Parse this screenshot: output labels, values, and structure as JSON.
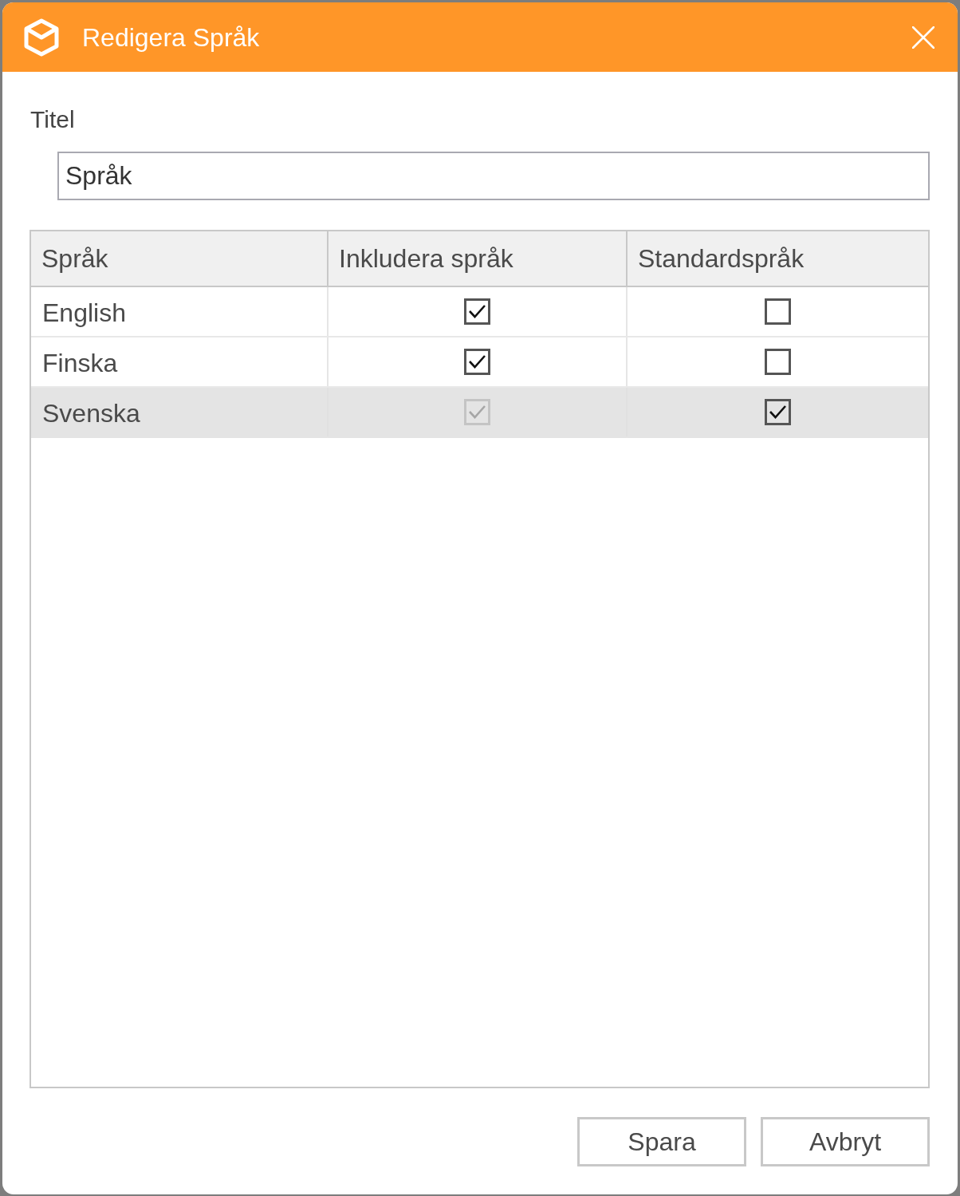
{
  "window": {
    "title": "Redigera Språk"
  },
  "form": {
    "label": "Titel",
    "value": "Språk"
  },
  "table": {
    "columns": [
      "Språk",
      "Inkludera språk",
      "Standardspråk"
    ],
    "rows": [
      {
        "language": "English",
        "selected": false,
        "include": {
          "checked": true,
          "disabled": false
        },
        "default": {
          "checked": false,
          "disabled": false
        }
      },
      {
        "language": "Finska",
        "selected": false,
        "include": {
          "checked": true,
          "disabled": false
        },
        "default": {
          "checked": false,
          "disabled": false
        }
      },
      {
        "language": "Svenska",
        "selected": true,
        "include": {
          "checked": true,
          "disabled": true
        },
        "default": {
          "checked": true,
          "disabled": false
        }
      }
    ]
  },
  "buttons": [
    "Spara",
    "Avbryt"
  ]
}
